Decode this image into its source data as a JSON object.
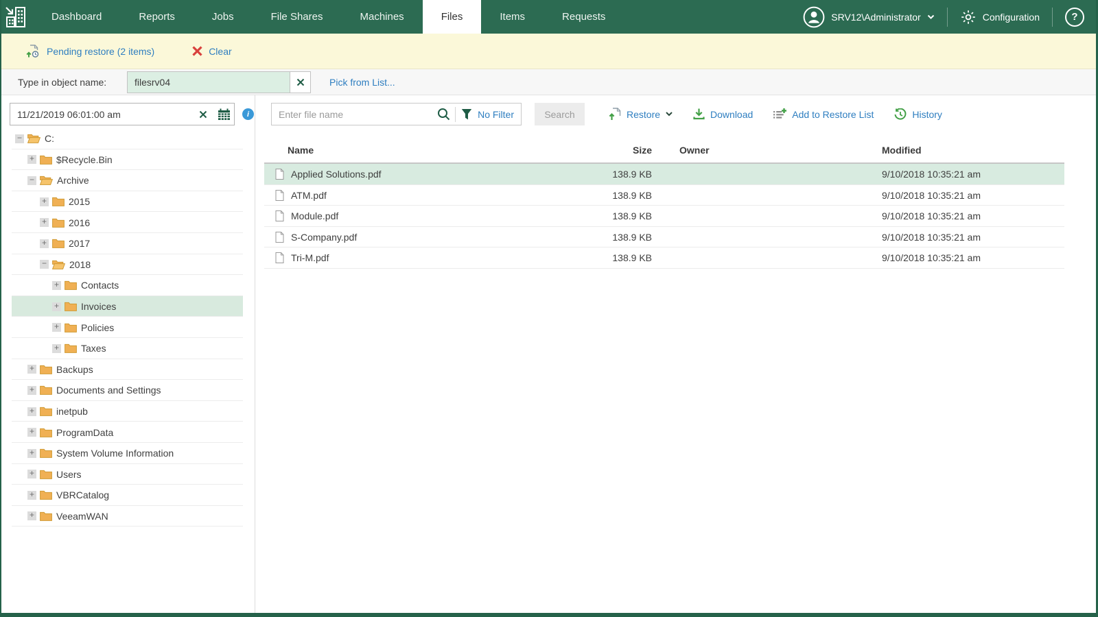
{
  "nav": {
    "tabs": [
      {
        "label": "Dashboard",
        "active": false
      },
      {
        "label": "Reports",
        "active": false
      },
      {
        "label": "Jobs",
        "active": false
      },
      {
        "label": "File Shares",
        "active": false
      },
      {
        "label": "Machines",
        "active": false
      },
      {
        "label": "Files",
        "active": true
      },
      {
        "label": "Items",
        "active": false
      },
      {
        "label": "Requests",
        "active": false
      }
    ],
    "user": "SRV12\\Administrator",
    "configuration_label": "Configuration",
    "help_label": "?"
  },
  "banner": {
    "pending_label": "Pending restore (2 items)",
    "clear_label": "Clear"
  },
  "object_bar": {
    "label": "Type in object name:",
    "value": "filesrv04",
    "pick_link": "Pick from List..."
  },
  "left_panel": {
    "datetime_value": "11/21/2019 06:01:00 am",
    "tree": [
      {
        "label": "C:",
        "level": 0,
        "expanded": true,
        "selected": false
      },
      {
        "label": "$Recycle.Bin",
        "level": 1,
        "expanded": false,
        "selected": false
      },
      {
        "label": "Archive",
        "level": 1,
        "expanded": true,
        "selected": false
      },
      {
        "label": "2015",
        "level": 2,
        "expanded": false,
        "selected": false
      },
      {
        "label": "2016",
        "level": 2,
        "expanded": false,
        "selected": false
      },
      {
        "label": "2017",
        "level": 2,
        "expanded": false,
        "selected": false
      },
      {
        "label": "2018",
        "level": 2,
        "expanded": true,
        "selected": false
      },
      {
        "label": "Contacts",
        "level": 3,
        "expanded": false,
        "selected": false
      },
      {
        "label": "Invoices",
        "level": 3,
        "expanded": false,
        "selected": true
      },
      {
        "label": "Policies",
        "level": 3,
        "expanded": false,
        "selected": false
      },
      {
        "label": "Taxes",
        "level": 3,
        "expanded": false,
        "selected": false
      },
      {
        "label": "Backups",
        "level": 1,
        "expanded": false,
        "selected": false
      },
      {
        "label": "Documents and Settings",
        "level": 1,
        "expanded": false,
        "selected": false
      },
      {
        "label": "inetpub",
        "level": 1,
        "expanded": false,
        "selected": false
      },
      {
        "label": "ProgramData",
        "level": 1,
        "expanded": false,
        "selected": false
      },
      {
        "label": "System Volume Information",
        "level": 1,
        "expanded": false,
        "selected": false
      },
      {
        "label": "Users",
        "level": 1,
        "expanded": false,
        "selected": false
      },
      {
        "label": "VBRCatalog",
        "level": 1,
        "expanded": false,
        "selected": false
      },
      {
        "label": "VeeamWAN",
        "level": 1,
        "expanded": false,
        "selected": false
      }
    ]
  },
  "toolbar": {
    "search_placeholder": "Enter file name",
    "filter_label": "No Filter",
    "search_button": "Search",
    "restore_label": "Restore",
    "download_label": "Download",
    "add_to_restore_label": "Add to Restore List",
    "history_label": "History"
  },
  "table": {
    "columns": [
      "Name",
      "Size",
      "Owner",
      "Modified"
    ],
    "rows": [
      {
        "name": "Applied Solutions.pdf",
        "size": "138.9 KB",
        "owner": "",
        "modified": "9/10/2018 10:35:21 am",
        "selected": true
      },
      {
        "name": "ATM.pdf",
        "size": "138.9 KB",
        "owner": "",
        "modified": "9/10/2018 10:35:21 am",
        "selected": false
      },
      {
        "name": "Module.pdf",
        "size": "138.9 KB",
        "owner": "",
        "modified": "9/10/2018 10:35:21 am",
        "selected": false
      },
      {
        "name": "S-Company.pdf",
        "size": "138.9 KB",
        "owner": "",
        "modified": "9/10/2018 10:35:21 am",
        "selected": false
      },
      {
        "name": "Tri-M.pdf",
        "size": "138.9 KB",
        "owner": "",
        "modified": "9/10/2018 10:35:21 am",
        "selected": false
      }
    ]
  },
  "colors": {
    "nav_green": "#2c6b52",
    "banner_yellow": "#fbf8d9",
    "link_blue": "#2e7ec0",
    "icon_green": "#43a047",
    "icon_dark_green": "#1e5c45",
    "clear_red": "#d9413d",
    "selection_green": "#d8ebe0",
    "folder_amber": "#f0b054"
  }
}
